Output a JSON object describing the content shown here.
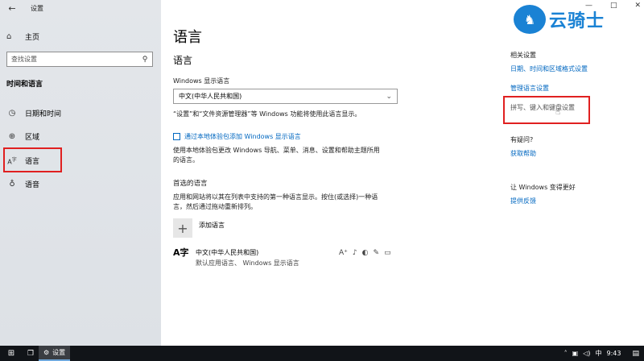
{
  "window": {
    "title": "设置",
    "controls": [
      "—",
      "□",
      "✕"
    ]
  },
  "sidebar": {
    "home_label": "主页",
    "search_placeholder": "查找设置",
    "section_title": "时间和语言",
    "items": [
      {
        "label": "日期和时间",
        "icon": "clock-icon"
      },
      {
        "label": "区域",
        "icon": "globe-icon"
      },
      {
        "label": "语言",
        "icon": "language-icon"
      },
      {
        "label": "语音",
        "icon": "microphone-icon"
      }
    ]
  },
  "main": {
    "page_title": "语言",
    "sub_title": "语言",
    "display_lang_label": "Windows 显示语言",
    "display_lang_value": "中文(中华人民共和国)",
    "display_lang_desc": "“设置”和“文件资源管理器”等 Windows 功能将使用此语言显示。",
    "add_pack_link": "通过本地体验包添加 Windows 显示语言",
    "add_pack_desc_1": "使用本地体验包更改 Windows 导航、菜单、消息、设置和帮助主题所用",
    "add_pack_desc_2": "的语言。",
    "preferred_title": "首选的语言",
    "preferred_desc_1": "应用和网站将以其在列表中支持的第一种语言显示。按住(或选择)一种语",
    "preferred_desc_2": "言，然后通过拖动重新排列。",
    "add_language_label": "添加语言",
    "language_entry": {
      "icon_text": "A字",
      "name": "中文(中华人民共和国)",
      "desc": "默认应用语言、 Windows 显示语言"
    }
  },
  "related": {
    "heading": "相关设置",
    "link1": "日期、时间和区域格式设置",
    "link2": "管理语言设置",
    "link3": "拼写、键入和键盘设置",
    "help_heading": "有疑问?",
    "help_link": "获取帮助",
    "feedback_heading": "让 Windows 变得更好",
    "feedback_link": "提供反馈"
  },
  "watermark": {
    "text": "云骑士"
  },
  "taskbar": {
    "app_label": "设置",
    "ime": "中",
    "time": "9:43"
  },
  "colors": {
    "accent": "#0067c0",
    "highlight": "#e02020"
  }
}
